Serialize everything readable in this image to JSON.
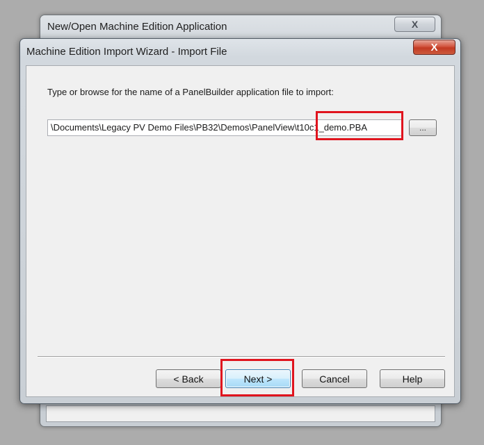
{
  "background_window": {
    "title": "New/Open Machine Edition Application",
    "close_glyph": "X"
  },
  "wizard": {
    "title": "Machine Edition Import Wizard - Import File",
    "close_glyph": "X",
    "prompt": "Type or browse for the name of a PanelBuilder application file to import:",
    "file_path": "\\Documents\\Legacy PV Demo Files\\PB32\\Demos\\PanelView\\t10c1_demo.PBA",
    "browse_label": "...",
    "buttons": {
      "back": "< Back",
      "next": "Next >",
      "cancel": "Cancel",
      "help": "Help"
    }
  },
  "annotations": {
    "color": "#e0141e"
  },
  "icons": [
    "close-icon"
  ]
}
